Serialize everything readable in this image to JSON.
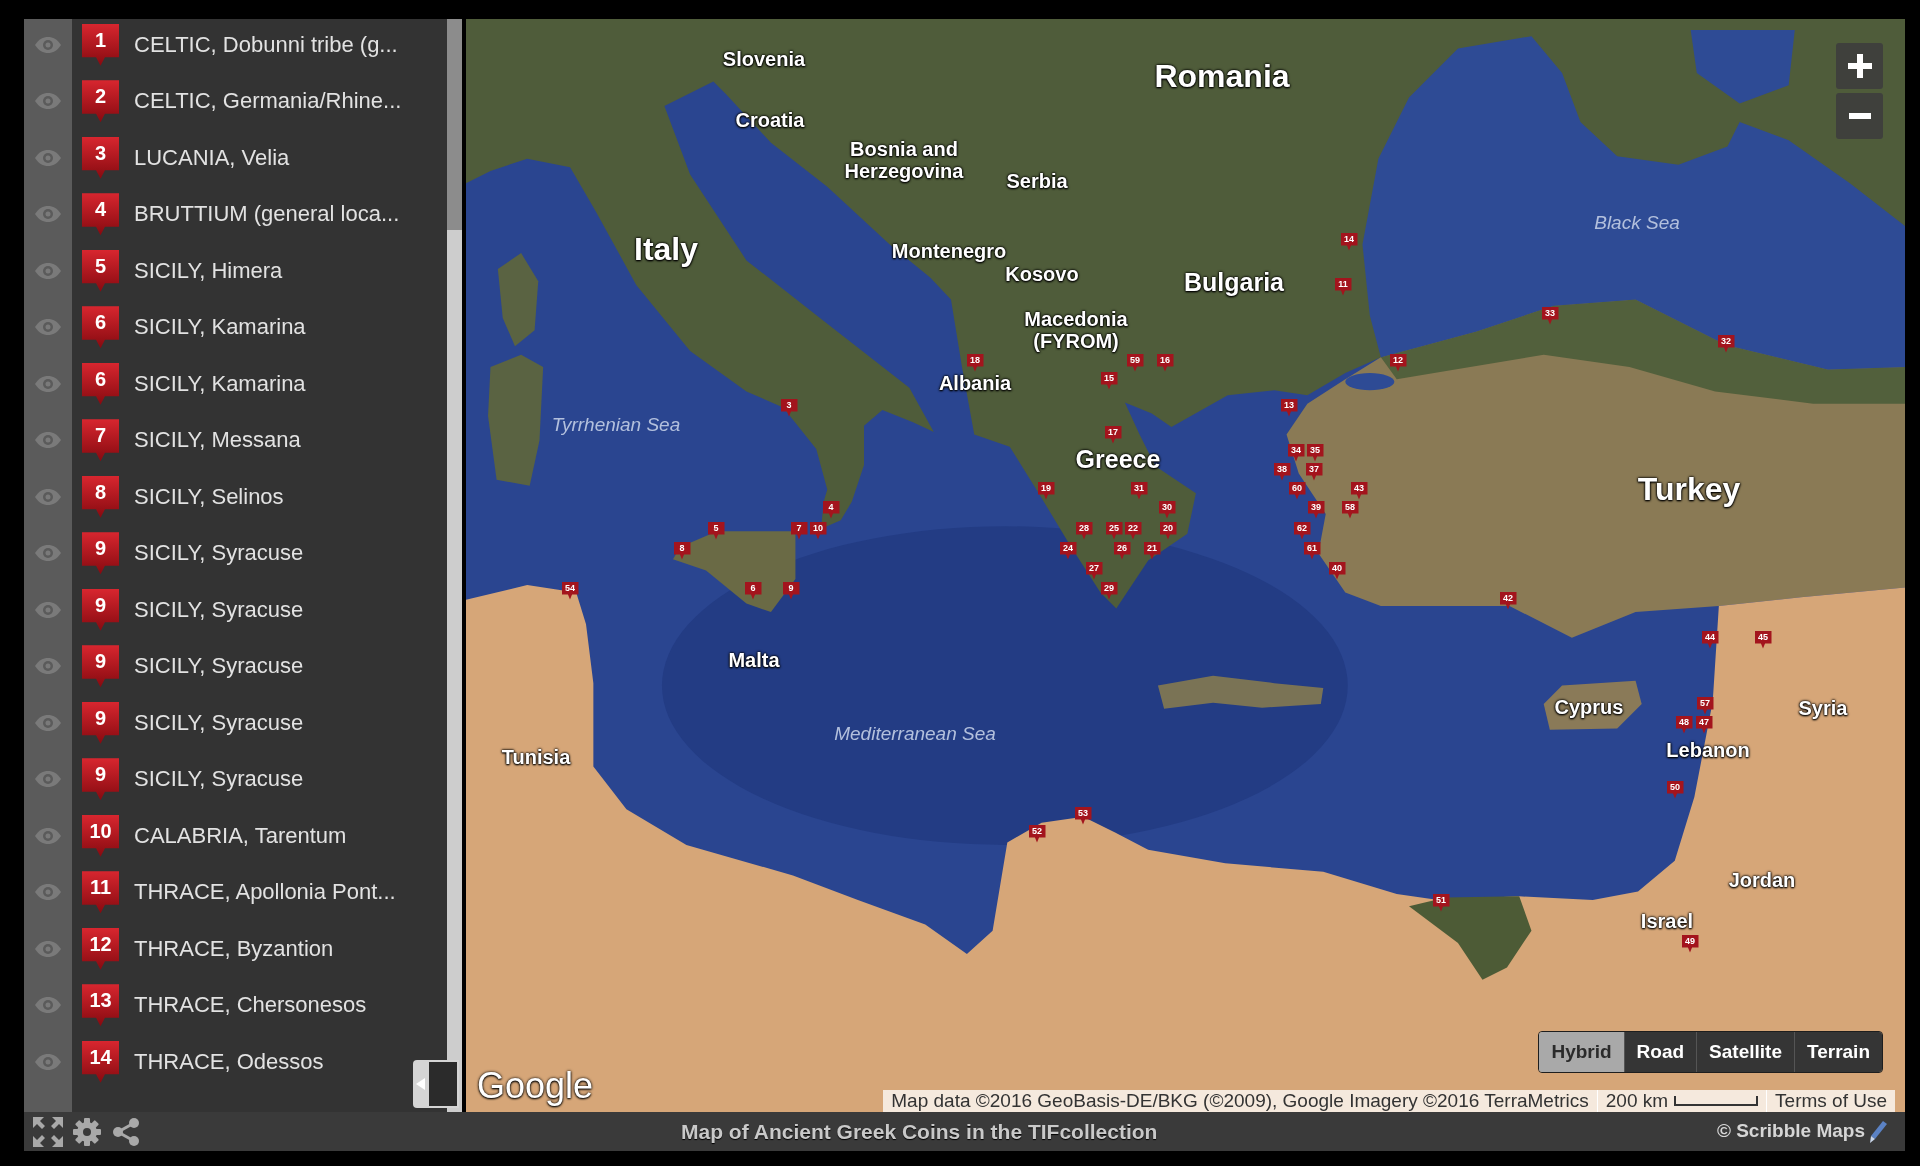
{
  "sidebar": {
    "items": [
      {
        "marker": "1",
        "label": "CELTIC, Dobunni tribe (g..."
      },
      {
        "marker": "2",
        "label": "CELTIC, Germania/Rhine..."
      },
      {
        "marker": "3",
        "label": "LUCANIA, Velia"
      },
      {
        "marker": "4",
        "label": "BRUTTIUM (general loca..."
      },
      {
        "marker": "5",
        "label": "SICILY, Himera"
      },
      {
        "marker": "6",
        "label": "SICILY, Kamarina"
      },
      {
        "marker": "6",
        "label": "SICILY, Kamarina"
      },
      {
        "marker": "7",
        "label": "SICILY, Messana"
      },
      {
        "marker": "8",
        "label": "SICILY, Selinos"
      },
      {
        "marker": "9",
        "label": "SICILY, Syracuse"
      },
      {
        "marker": "9",
        "label": "SICILY, Syracuse"
      },
      {
        "marker": "9",
        "label": "SICILY, Syracuse"
      },
      {
        "marker": "9",
        "label": "SICILY, Syracuse"
      },
      {
        "marker": "9",
        "label": "SICILY, Syracuse"
      },
      {
        "marker": "10",
        "label": "CALABRIA, Tarentum"
      },
      {
        "marker": "11",
        "label": "THRACE, Apollonia Pont..."
      },
      {
        "marker": "12",
        "label": "THRACE, Byzantion"
      },
      {
        "marker": "13",
        "label": "THRACE, Chersonesos"
      },
      {
        "marker": "14",
        "label": "THRACE, Odessos"
      }
    ]
  },
  "map": {
    "labels": [
      {
        "text": "Slovenia",
        "kind": "country"
      },
      {
        "text": "Romania",
        "kind": "country"
      },
      {
        "text": "Croatia",
        "kind": "country"
      },
      {
        "text": "Bosnia and Herzegovina",
        "kind": "country"
      },
      {
        "text": "Serbia",
        "kind": "country"
      },
      {
        "text": "Black Sea",
        "kind": "sea"
      },
      {
        "text": "Italy",
        "kind": "country"
      },
      {
        "text": "Montenegro",
        "kind": "country"
      },
      {
        "text": "Kosovo",
        "kind": "country"
      },
      {
        "text": "Bulgaria",
        "kind": "country"
      },
      {
        "text": "Macedonia (FYROM)",
        "kind": "country"
      },
      {
        "text": "Albania",
        "kind": "country"
      },
      {
        "text": "Tyrrhenian Sea",
        "kind": "sea"
      },
      {
        "text": "Greece",
        "kind": "country"
      },
      {
        "text": "Turkey",
        "kind": "country"
      },
      {
        "text": "Malta",
        "kind": "country"
      },
      {
        "text": "Cyprus",
        "kind": "country"
      },
      {
        "text": "Syria",
        "kind": "country"
      },
      {
        "text": "Mediterranean Sea",
        "kind": "sea"
      },
      {
        "text": "Tunisia",
        "kind": "country"
      },
      {
        "text": "Lebanon",
        "kind": "country"
      },
      {
        "text": "Jordan",
        "kind": "country"
      },
      {
        "text": "Israel",
        "kind": "country"
      }
    ],
    "markers": [
      "14",
      "11",
      "33",
      "32",
      "18",
      "59",
      "16",
      "12",
      "15",
      "3",
      "13",
      "17",
      "34",
      "35",
      "38",
      "37",
      "19",
      "31",
      "60",
      "43",
      "4",
      "30",
      "39",
      "58",
      "5",
      "7",
      "10",
      "28",
      "25",
      "22",
      "20",
      "62",
      "8",
      "24",
      "26",
      "21",
      "61",
      "27",
      "40",
      "54",
      "6",
      "9",
      "29",
      "42",
      "44",
      "45",
      "57",
      "48",
      "47",
      "50",
      "53",
      "52",
      "51",
      "49"
    ],
    "map_types": [
      {
        "label": "Hybrid",
        "selected": true
      },
      {
        "label": "Road",
        "selected": false
      },
      {
        "label": "Satellite",
        "selected": false
      },
      {
        "label": "Terrain",
        "selected": false
      }
    ],
    "logo": "Google",
    "attribution": "Map data ©2016 GeoBasis-DE/BKG (©2009), Google Imagery ©2016 TerraMetrics",
    "scale": "200 km",
    "terms": "Terms of Use"
  },
  "footer": {
    "title": "Map of Ancient Greek Coins in the TIFcollection",
    "credit": "© Scribble Maps"
  }
}
